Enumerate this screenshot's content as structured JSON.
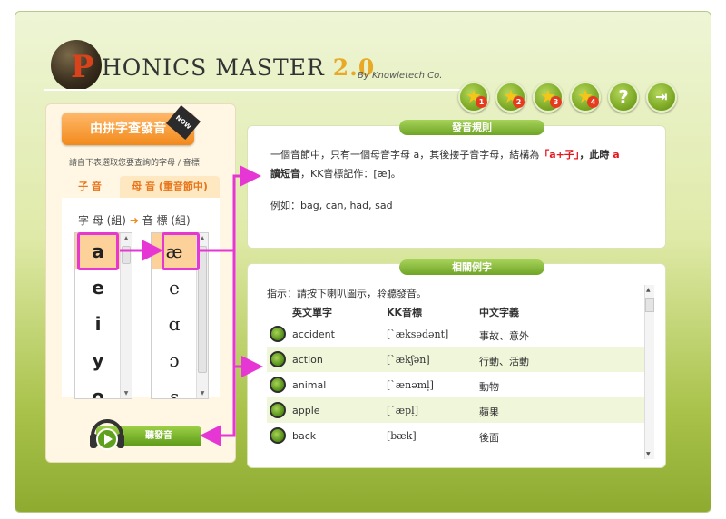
{
  "app": {
    "logo_initial": "P",
    "logo_rest": "HONICS MASTER",
    "logo_version": "2.0",
    "byline": "By Knowletech Co."
  },
  "toolbar": {
    "level_buttons": [
      "1",
      "2",
      "3",
      "4"
    ],
    "help_label": "?",
    "exit_label": "⇥"
  },
  "left": {
    "query_button": "由拼字查發音",
    "badge": "NOW",
    "instruction": "請自下表選取您要查詢的字母 / 音標",
    "tabs": [
      {
        "label": "子 音"
      },
      {
        "label": "母 音 (重音節中)"
      }
    ],
    "letters_header": "字 母 (組)",
    "arrow": "➜",
    "phonetic_header": "音 標 (組)",
    "letters": [
      "a",
      "e",
      "i",
      "y",
      "o"
    ],
    "phonetics": [
      "æ",
      "e",
      "ɑ",
      "ɔ",
      "ɛ"
    ],
    "selected_index": 0,
    "listen_button": "聽發音"
  },
  "rule": {
    "title": "發音規則",
    "text_part1": "一個音節中，只有一個母音字母 a，其後接子音字母，結構為",
    "text_red1": "「a+子」",
    "text_part2": "，此時",
    "text_red2": " a",
    "text_bold": "讀短音",
    "text_part3": "，KK音標記作：[æ]。",
    "example": "例如：bag, can, had, sad"
  },
  "examples": {
    "title": "相關例字",
    "instruction": "指示：請按下喇叭圖示，聆聽發音。",
    "columns": [
      "英文單字",
      "KK音標",
      "中文字義"
    ],
    "rows": [
      {
        "word": "accident",
        "kk": "[`æksədənt]",
        "meaning": "事故、意外"
      },
      {
        "word": "action",
        "kk": "[`ækʃən]",
        "meaning": "行動、活動"
      },
      {
        "word": "animal",
        "kk": "[`ænəml̩]",
        "meaning": "動物"
      },
      {
        "word": "apple",
        "kk": "[`æpl̩]",
        "meaning": "蘋果"
      },
      {
        "word": "back",
        "kk": "[bæk]",
        "meaning": "後面"
      }
    ]
  },
  "colors": {
    "accent_orange": "#f28a1c",
    "accent_green": "#6ea426",
    "highlight": "#e636d4",
    "rule_red": "#e4151c"
  }
}
